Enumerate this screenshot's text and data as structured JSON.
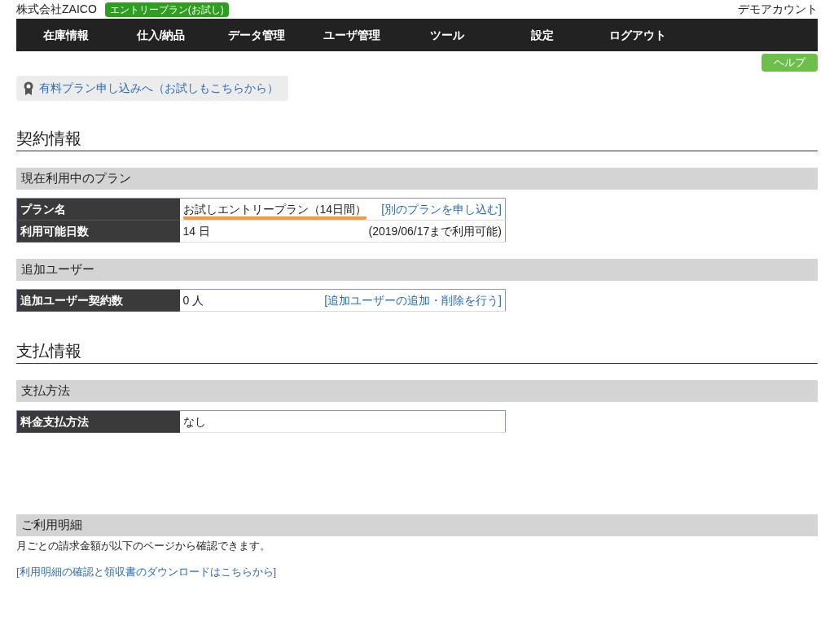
{
  "header": {
    "company": "株式会社ZAICO",
    "plan_badge": "エントリープラン(お試し)",
    "account": "デモアカウント"
  },
  "nav": [
    "在庫情報",
    "仕入/納品",
    "データ管理",
    "ユーザ管理",
    "ツール",
    "設定",
    "ログアウト"
  ],
  "help_button": "ヘルプ",
  "paid_plan_link": "有料プラン申し込みへ（お試しもこちらから）",
  "sections": [
    {
      "title": "契約情報",
      "groups": [
        {
          "title": "現在利用中のプラン",
          "rows": [
            {
              "label": "プラン名",
              "value": "お試しエントリープラン（14日間）",
              "underlined": true,
              "aside": {
                "kind": "link",
                "text": "[別のプランを申し込む]"
              }
            },
            {
              "label": "利用可能日数",
              "value": "14 日",
              "underlined": false,
              "aside": {
                "kind": "note",
                "text": "(2019/06/17まで利用可能)"
              }
            }
          ]
        },
        {
          "title": "追加ユーザー",
          "rows": [
            {
              "label": "追加ユーザー契約数",
              "value": "0 人",
              "underlined": false,
              "aside": {
                "kind": "link",
                "text": "[追加ユーザーの追加・削除を行う]"
              }
            }
          ]
        }
      ]
    },
    {
      "title": "支払情報",
      "groups": [
        {
          "title": "支払方法",
          "rows": [
            {
              "label": "料金支払方法",
              "value": "なし",
              "underlined": false
            }
          ]
        }
      ]
    }
  ],
  "statement": {
    "title": "ご利用明細",
    "description": "月ごとの請求金額が以下のページから確認できます。",
    "link": "[利用明細の確認と領収書のダウンロードはこちらから]"
  }
}
